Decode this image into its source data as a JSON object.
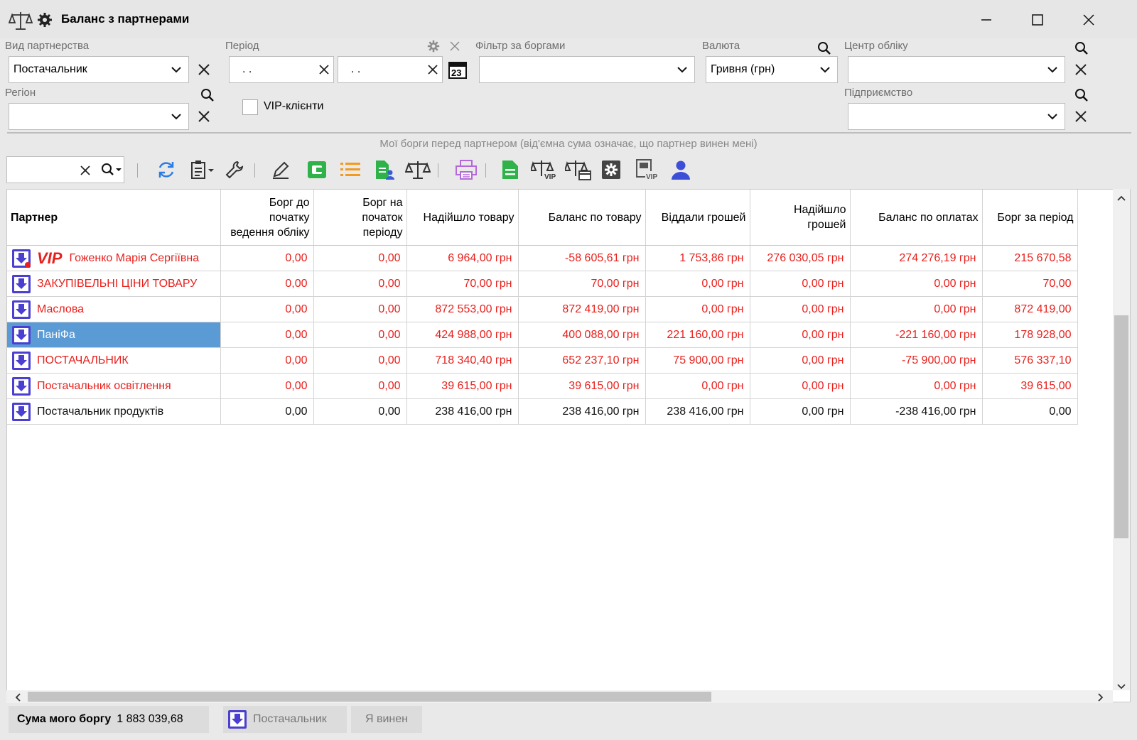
{
  "window": {
    "title": "Баланс з партнерами"
  },
  "filters": {
    "partnership": {
      "label": "Вид партнерства",
      "value": "Постачальник"
    },
    "period": {
      "label": "Період",
      "from": ". .",
      "to": ". .",
      "calendar_day": "23"
    },
    "debt_filter": {
      "label": "Фільтр за боргами",
      "value": ""
    },
    "currency": {
      "label": "Валюта",
      "value": "Гривня (грн)"
    },
    "center": {
      "label": "Центр обліку",
      "value": ""
    },
    "region": {
      "label": "Регіон",
      "value": ""
    },
    "vip": {
      "label": "VIP-клієнти",
      "checked": false
    },
    "enterprise": {
      "label": "Підприємство",
      "value": ""
    }
  },
  "hint": "Мої борги перед партнером (від'ємна сума означає, що партнер винен мені)",
  "search": {
    "value": ""
  },
  "grid": {
    "columns": [
      {
        "label": "Партнер"
      },
      {
        "label": "Борг до початку ведення обліку",
        "lines": [
          "Борг до",
          "початку",
          "ведення обліку"
        ]
      },
      {
        "label": "Борг на початок періоду",
        "lines": [
          "Борг на",
          "початок",
          "періоду"
        ]
      },
      {
        "label": "Надійшло товару",
        "lines": [
          "Надійшло товару"
        ]
      },
      {
        "label": "Баланс по товару",
        "lines": [
          "Баланс по товару"
        ]
      },
      {
        "label": "Віддали грошей",
        "lines": [
          "Віддали грошей"
        ]
      },
      {
        "label": "Надійшло грошей",
        "lines": [
          "Надійшло",
          "грошей"
        ]
      },
      {
        "label": "Баланс по оплатах",
        "lines": [
          "Баланс по оплатах"
        ]
      },
      {
        "label": "Борг за період",
        "lines": [
          "Борг за період"
        ]
      }
    ],
    "rows": [
      {
        "partner": "Гоженко Марія Сергіївна",
        "vip_badge": "VIP",
        "color": "red",
        "selected": false,
        "values": [
          "0,00",
          "0,00",
          "6 964,00 грн",
          "-58 605,61 грн",
          "1 753,86 грн",
          "276 030,05 грн",
          "274 276,19 грн",
          "215 670,58"
        ]
      },
      {
        "partner": "ЗАКУПІВЕЛЬНІ ЦІНИ ТОВАРУ",
        "color": "red",
        "selected": false,
        "values": [
          "0,00",
          "0,00",
          "70,00 грн",
          "70,00 грн",
          "0,00 грн",
          "0,00 грн",
          "0,00 грн",
          "70,00"
        ]
      },
      {
        "partner": "Маслова",
        "color": "red",
        "selected": false,
        "values": [
          "0,00",
          "0,00",
          "872 553,00 грн",
          "872 419,00 грн",
          "0,00 грн",
          "0,00 грн",
          "0,00 грн",
          "872 419,00"
        ]
      },
      {
        "partner": "ПаніФа",
        "color": "red",
        "selected": true,
        "values": [
          "0,00",
          "0,00",
          "424 988,00 грн",
          "400 088,00 грн",
          "221 160,00 грн",
          "0,00 грн",
          "-221 160,00 грн",
          "178 928,00"
        ]
      },
      {
        "partner": "ПОСТАЧАЛЬНИК",
        "color": "red",
        "selected": false,
        "values": [
          "0,00",
          "0,00",
          "718 340,40 грн",
          "652 237,10 грн",
          "75 900,00 грн",
          "0,00 грн",
          "-75 900,00 грн",
          "576 337,10"
        ]
      },
      {
        "partner": "Постачальник освітлення",
        "color": "red",
        "selected": false,
        "values": [
          "0,00",
          "0,00",
          "39 615,00 грн",
          "39 615,00 грн",
          "0,00 грн",
          "0,00 грн",
          "0,00 грн",
          "39 615,00"
        ]
      },
      {
        "partner": "Постачальник продуктів",
        "color": "black",
        "selected": false,
        "values": [
          "0,00",
          "0,00",
          "238 416,00 грн",
          "238 416,00 грн",
          "238 416,00 грн",
          "0,00 грн",
          "-238 416,00 грн",
          "0,00"
        ]
      }
    ]
  },
  "status": {
    "debt_label": "Сума мого боргу",
    "debt_value": "1 883 039,68",
    "type_label": "Постачальник",
    "owe_label": "Я винен"
  },
  "colors": {
    "red_text": "#e8201c",
    "selected_row": "#5b9bd5",
    "icon_blue": "#4a3fd0"
  }
}
